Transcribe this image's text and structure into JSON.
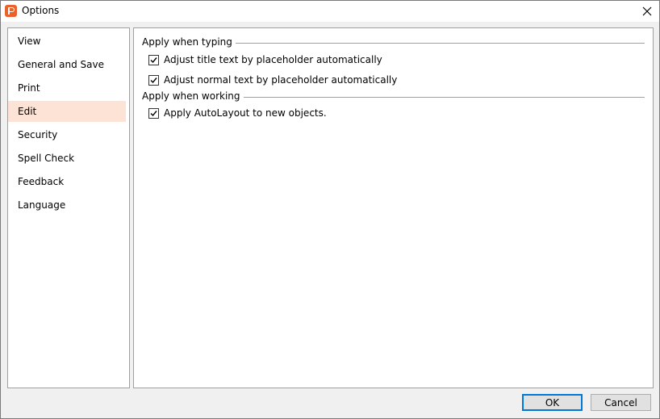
{
  "window": {
    "title": "Options"
  },
  "sidebar": {
    "items": [
      {
        "label": "View"
      },
      {
        "label": "General and Save"
      },
      {
        "label": "Print"
      },
      {
        "label": "Edit"
      },
      {
        "label": "Security"
      },
      {
        "label": "Spell Check"
      },
      {
        "label": "Feedback"
      },
      {
        "label": "Language"
      }
    ],
    "selected": "Edit",
    "selected_color": "#fde3d6"
  },
  "content": {
    "groups": [
      {
        "title": "Apply when typing",
        "options": [
          {
            "label": "Adjust title text by placeholder automatically",
            "checked": true
          },
          {
            "label": "Adjust normal text by placeholder automatically",
            "checked": true
          }
        ]
      },
      {
        "title": "Apply when working",
        "options": [
          {
            "label": "Apply AutoLayout to new objects.",
            "checked": true
          }
        ]
      }
    ]
  },
  "buttons": {
    "ok": "OK",
    "cancel": "Cancel"
  },
  "colors": {
    "accent": "#e8622b",
    "focus": "#0078d7"
  },
  "icons": {
    "app": "powerpoint-app-icon",
    "close": "close-icon",
    "check": "checkmark-icon"
  }
}
